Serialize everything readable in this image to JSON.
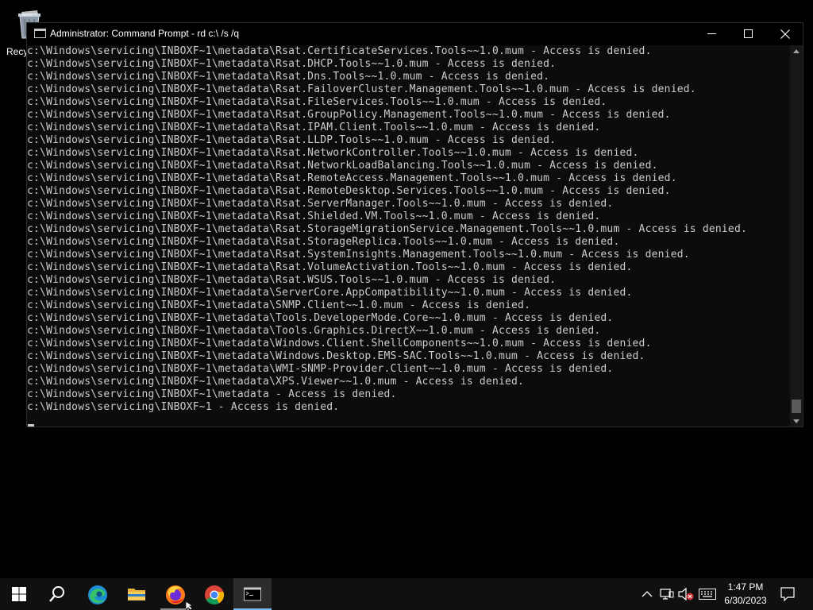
{
  "desktop": {
    "recycle_bin_label": "Recyc"
  },
  "window": {
    "title": "Administrator:  Command Prompt - rd  c:\\ /s /q",
    "icon": "cmd-icon"
  },
  "console_lines": [
    "c:\\Windows\\servicing\\INBOXF~1\\metadata\\Rsat.CertificateServices.Tools~~1.0.mum - Access is denied.",
    "c:\\Windows\\servicing\\INBOXF~1\\metadata\\Rsat.DHCP.Tools~~1.0.mum - Access is denied.",
    "c:\\Windows\\servicing\\INBOXF~1\\metadata\\Rsat.Dns.Tools~~1.0.mum - Access is denied.",
    "c:\\Windows\\servicing\\INBOXF~1\\metadata\\Rsat.FailoverCluster.Management.Tools~~1.0.mum - Access is denied.",
    "c:\\Windows\\servicing\\INBOXF~1\\metadata\\Rsat.FileServices.Tools~~1.0.mum - Access is denied.",
    "c:\\Windows\\servicing\\INBOXF~1\\metadata\\Rsat.GroupPolicy.Management.Tools~~1.0.mum - Access is denied.",
    "c:\\Windows\\servicing\\INBOXF~1\\metadata\\Rsat.IPAM.Client.Tools~~1.0.mum - Access is denied.",
    "c:\\Windows\\servicing\\INBOXF~1\\metadata\\Rsat.LLDP.Tools~~1.0.mum - Access is denied.",
    "c:\\Windows\\servicing\\INBOXF~1\\metadata\\Rsat.NetworkController.Tools~~1.0.mum - Access is denied.",
    "c:\\Windows\\servicing\\INBOXF~1\\metadata\\Rsat.NetworkLoadBalancing.Tools~~1.0.mum - Access is denied.",
    "c:\\Windows\\servicing\\INBOXF~1\\metadata\\Rsat.RemoteAccess.Management.Tools~~1.0.mum - Access is denied.",
    "c:\\Windows\\servicing\\INBOXF~1\\metadata\\Rsat.RemoteDesktop.Services.Tools~~1.0.mum - Access is denied.",
    "c:\\Windows\\servicing\\INBOXF~1\\metadata\\Rsat.ServerManager.Tools~~1.0.mum - Access is denied.",
    "c:\\Windows\\servicing\\INBOXF~1\\metadata\\Rsat.Shielded.VM.Tools~~1.0.mum - Access is denied.",
    "c:\\Windows\\servicing\\INBOXF~1\\metadata\\Rsat.StorageMigrationService.Management.Tools~~1.0.mum - Access is denied.",
    "c:\\Windows\\servicing\\INBOXF~1\\metadata\\Rsat.StorageReplica.Tools~~1.0.mum - Access is denied.",
    "c:\\Windows\\servicing\\INBOXF~1\\metadata\\Rsat.SystemInsights.Management.Tools~~1.0.mum - Access is denied.",
    "c:\\Windows\\servicing\\INBOXF~1\\metadata\\Rsat.VolumeActivation.Tools~~1.0.mum - Access is denied.",
    "c:\\Windows\\servicing\\INBOXF~1\\metadata\\Rsat.WSUS.Tools~~1.0.mum - Access is denied.",
    "c:\\Windows\\servicing\\INBOXF~1\\metadata\\ServerCore.AppCompatibility~~1.0.mum - Access is denied.",
    "c:\\Windows\\servicing\\INBOXF~1\\metadata\\SNMP.Client~~1.0.mum - Access is denied.",
    "c:\\Windows\\servicing\\INBOXF~1\\metadata\\Tools.DeveloperMode.Core~~1.0.mum - Access is denied.",
    "c:\\Windows\\servicing\\INBOXF~1\\metadata\\Tools.Graphics.DirectX~~1.0.mum - Access is denied.",
    "c:\\Windows\\servicing\\INBOXF~1\\metadata\\Windows.Client.ShellComponents~~1.0.mum - Access is denied.",
    "c:\\Windows\\servicing\\INBOXF~1\\metadata\\Windows.Desktop.EMS-SAC.Tools~~1.0.mum - Access is denied.",
    "c:\\Windows\\servicing\\INBOXF~1\\metadata\\WMI-SNMP-Provider.Client~~1.0.mum - Access is denied.",
    "c:\\Windows\\servicing\\INBOXF~1\\metadata\\XPS.Viewer~~1.0.mum - Access is denied.",
    "c:\\Windows\\servicing\\INBOXF~1\\metadata - Access is denied.",
    "c:\\Windows\\servicing\\INBOXF~1 - Access is denied."
  ],
  "taskbar": {
    "items": [
      {
        "name": "start-button",
        "icon": "windows-logo-icon"
      },
      {
        "name": "search-button",
        "icon": "search-icon"
      },
      {
        "name": "edge-button",
        "icon": "edge-icon"
      },
      {
        "name": "file-explorer-button",
        "icon": "folder-icon"
      },
      {
        "name": "firefox-button",
        "icon": "firefox-icon"
      },
      {
        "name": "chrome-button",
        "icon": "chrome-icon"
      },
      {
        "name": "command-prompt-button",
        "icon": "cmd-icon"
      }
    ],
    "tray": [
      "chevron-up-icon",
      "network-icon",
      "volume-muted-icon",
      "keyboard-icon"
    ],
    "time": "1:47 PM",
    "date": "6/30/2023",
    "notification_icon": "notification-icon"
  },
  "colors": {
    "console_bg": "#0c0c0c",
    "console_text": "#cccccc",
    "taskbar_bg": "#101010",
    "active_indicator": "#76b9ed"
  }
}
